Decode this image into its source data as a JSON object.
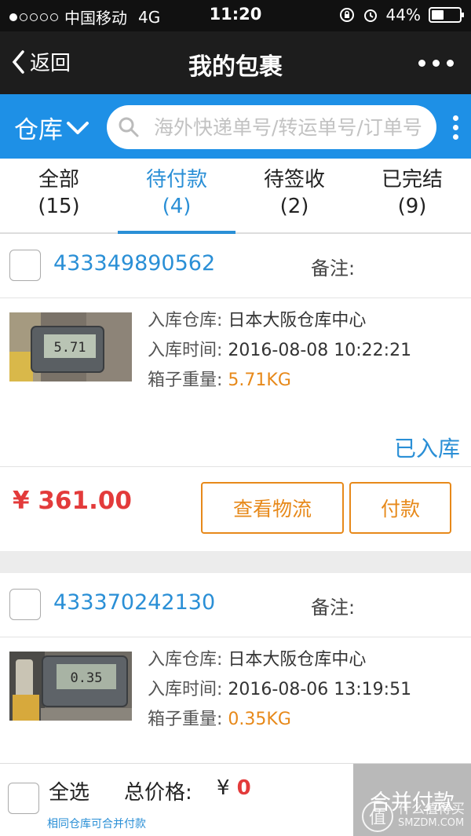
{
  "status_bar": {
    "carrier": "中国移动",
    "network": "4G",
    "time": "11:20",
    "battery": "44%",
    "battery_level": 0.44
  },
  "nav": {
    "back_label": "返回",
    "title": "我的包裹"
  },
  "search": {
    "warehouse_label": "仓库",
    "placeholder": "海外快递单号/转运单号/订单号"
  },
  "tabs": [
    {
      "label": "全部",
      "count": "(15)",
      "active": false
    },
    {
      "label": "待付款",
      "count": "(4)",
      "active": true
    },
    {
      "label": "待签收",
      "count": "(2)",
      "active": false
    },
    {
      "label": "已完结",
      "count": "(9)",
      "active": false
    }
  ],
  "packages": [
    {
      "number": "433349890562",
      "note_label": "备注:",
      "warehouse_label": "入库仓库:",
      "warehouse": "日本大阪仓库中心",
      "time_label": "入库时间:",
      "time": "2016-08-08 10:22:21",
      "weight_label": "箱子重量:",
      "weight": "5.71KG",
      "scale_reading": "5.71",
      "status": "已入库",
      "price": "¥ 361.00",
      "logistics_button": "查看物流",
      "pay_button": "付款"
    },
    {
      "number": "433370242130",
      "note_label": "备注:",
      "warehouse_label": "入库仓库:",
      "warehouse": "日本大阪仓库中心",
      "time_label": "入库时间:",
      "time": "2016-08-06 13:19:51",
      "weight_label": "箱子重量:",
      "weight": "0.35KG",
      "scale_reading": "0.35"
    }
  ],
  "footer": {
    "select_all": "全选",
    "total_label": "总价格:",
    "total_currency": "¥",
    "total_value": "0",
    "hint": "相同仓库可合并付款",
    "merge_pay": "合并付款"
  },
  "watermark": {
    "logo_char": "值",
    "line1": "什么值得买",
    "line2": "SMZDM.COM"
  },
  "colors": {
    "blue": "#1e90e6",
    "link_blue": "#2a8fd6",
    "orange": "#e7891a",
    "red": "#e33b3b"
  }
}
